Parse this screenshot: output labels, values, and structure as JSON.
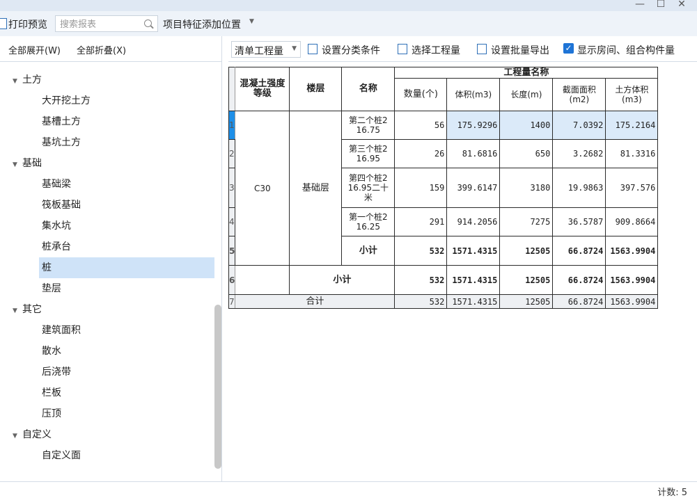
{
  "toolbar": {
    "print_label": "打印预览",
    "search_placeholder": "搜索报表",
    "position_label": "项目特征添加位置"
  },
  "left_panel": {
    "expand_all": "全部展开(W)",
    "collapse_all": "全部折叠(X)",
    "tree": [
      {
        "label": "土方",
        "children": [
          "大开挖土方",
          "基槽土方",
          "基坑土方"
        ]
      },
      {
        "label": "基础",
        "children": [
          "基础梁",
          "筏板基础",
          "集水坑",
          "桩承台",
          "桩",
          "垫层"
        ]
      },
      {
        "label": "其它",
        "children": [
          "建筑面积",
          "散水",
          "后浇带",
          "栏板",
          "压顶"
        ]
      },
      {
        "label": "自定义",
        "children": [
          "自定义面"
        ]
      }
    ],
    "selected": "桩"
  },
  "right_toolbar": {
    "select_value": "清单工程量",
    "set_category": "设置分类条件",
    "select_quantity": "选择工程量",
    "batch_export": "设置批量导出",
    "show_rooms": "显示房间、组合构件量",
    "show_rooms_checked": true
  },
  "table": {
    "group_header": "工程量名称",
    "col_grade": "混凝土强度等级",
    "col_floor": "楼层",
    "col_name": "名称",
    "col_count": "数量(个)",
    "col_volume": "体积(m3)",
    "col_length": "长度(m)",
    "col_area": "截面面积(m2)",
    "col_earth": "土方体积(m3)",
    "grade": "C30",
    "floor": "基础层",
    "rows": [
      {
        "no": "1",
        "name": "第二个桩2 16.75",
        "count": "56",
        "volume": "175.9296",
        "length": "1400",
        "area": "7.0392",
        "earth": "175.2164"
      },
      {
        "no": "2",
        "name": "第三个桩2 16.95",
        "count": "26",
        "volume": "81.6816",
        "length": "650",
        "area": "3.2682",
        "earth": "81.3316"
      },
      {
        "no": "3",
        "name": "第四个桩2 16.95二十米",
        "count": "159",
        "volume": "399.6147",
        "length": "3180",
        "area": "19.9863",
        "earth": "397.576"
      },
      {
        "no": "4",
        "name": "第一个桩2 16.25",
        "count": "291",
        "volume": "914.2056",
        "length": "7275",
        "area": "36.5787",
        "earth": "909.8664"
      }
    ],
    "subtotal_label": "小计",
    "subtotal_row_no": "5",
    "floor_subtotal_row_no": "6",
    "subtotal": {
      "count": "532",
      "volume": "1571.4315",
      "length": "12505",
      "area": "66.8724",
      "earth": "1563.9904"
    },
    "total_label": "合计",
    "total_row_no": "7",
    "total": {
      "count": "532",
      "volume": "1571.4315",
      "length": "12505",
      "area": "66.8724",
      "earth": "1563.9904"
    }
  },
  "status": {
    "count_text": "计数: 5"
  }
}
